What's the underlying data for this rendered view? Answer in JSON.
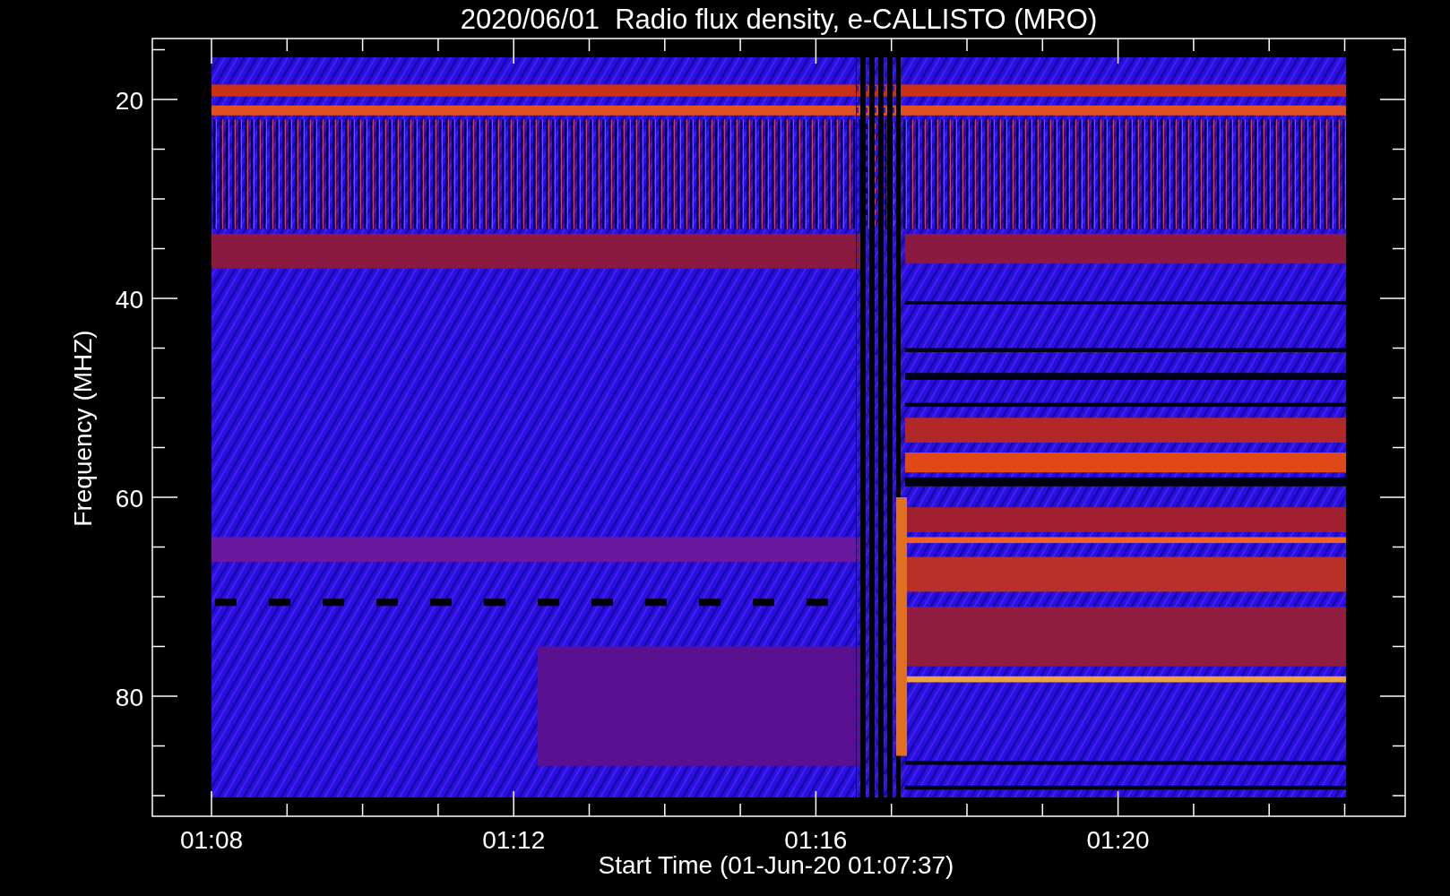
{
  "chart": {
    "title": "2020/06/01  Radio flux density, e-CALLISTO (MRO)",
    "ylabel": "Frequency (MHZ)",
    "xlabel": "Start Time (01-Jun-20 01:07:37)",
    "y_tick_labels": [
      "20",
      "40",
      "60",
      "80"
    ],
    "x_tick_labels": [
      "01:08",
      "01:12",
      "01:16",
      "01:20"
    ]
  }
}
